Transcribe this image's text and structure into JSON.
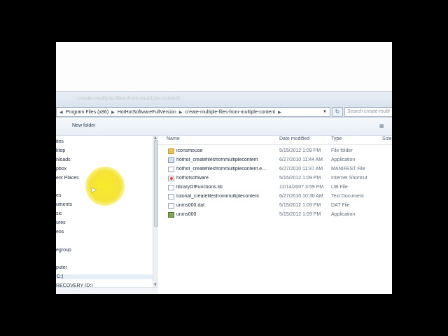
{
  "window": {
    "title_ghost": "create-multiple-files-from-multiple-content"
  },
  "address": {
    "segments": [
      "Program Files (x86)",
      "HotHotSoftwareFullVersion",
      "create-multiple-files-from-multiple-content"
    ],
    "search_placeholder": "Search create-multi"
  },
  "toolbar": {
    "new_folder": "New folder"
  },
  "nav": {
    "items": [
      {
        "label": "ites"
      },
      {
        "label": "ktop"
      },
      {
        "label": "nloads"
      },
      {
        "label": "pbox"
      },
      {
        "label": "ent Places"
      },
      {
        "label": "es"
      },
      {
        "label": "uments"
      },
      {
        "label": "sic"
      },
      {
        "label": "ures"
      },
      {
        "label": "eos"
      },
      {
        "label": "egroup"
      },
      {
        "label": "puter"
      },
      {
        "label": "C:)"
      },
      {
        "label": "RECOVERY (D:)"
      }
    ]
  },
  "columns": {
    "name": "Name",
    "date": "Date modified",
    "type": "Type",
    "size": "Size"
  },
  "files": [
    {
      "name": "iconsmouse",
      "date": "5/15/2012 1:09 PM",
      "type": "File folder",
      "icon": "folder-icon"
    },
    {
      "name": "hothot_createfilesfrommultiplecontent",
      "date": "6/27/2010 11:44 AM",
      "type": "Application",
      "icon": "application-icon"
    },
    {
      "name": "hothot_createfilesfrommultiplecontent.e...",
      "date": "6/27/2010 11:37 AM",
      "type": "MANIFEST File",
      "icon": "file-icon"
    },
    {
      "name": "hothotsoftware",
      "date": "5/15/2012 1:09 PM",
      "type": "Internet Shortcut",
      "icon": "internet-shortcut-icon"
    },
    {
      "name": "libraryOfFunctions.lib",
      "date": "12/14/2007 3:59 PM",
      "type": "LIB File",
      "icon": "file-icon"
    },
    {
      "name": "tutorial_createfilesfrommultiplecontent",
      "date": "6/27/2010 10:30 AM",
      "type": "Text Document",
      "icon": "text-document-icon"
    },
    {
      "name": "unins000.dat",
      "date": "5/15/2012 1:09 PM",
      "type": "DAT File",
      "icon": "file-icon"
    },
    {
      "name": "unins000",
      "date": "5/15/2012 1:09 PM",
      "type": "Application",
      "icon": "uninstaller-icon"
    }
  ]
}
